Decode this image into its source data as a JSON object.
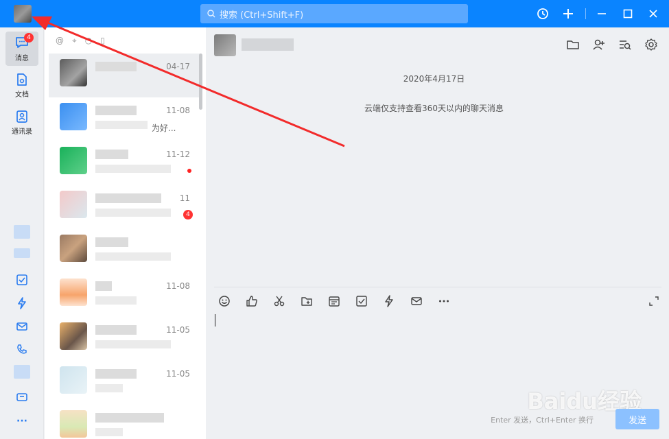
{
  "titlebar": {
    "search_placeholder": "搜索 (Ctrl+Shift+F)"
  },
  "nav": {
    "messages_label": "消息",
    "messages_badge": "4",
    "docs_label": "文档",
    "contacts_label": "通讯录",
    "more_label": "···"
  },
  "conversations": [
    {
      "date": "04-17",
      "preview_text": ""
    },
    {
      "date": "11-08",
      "preview_text": "为好..."
    },
    {
      "date": "11-12",
      "preview_text": ""
    },
    {
      "date": "11",
      "preview_text": "",
      "badge": "4"
    },
    {
      "date": "",
      "preview_text": ""
    },
    {
      "date": "11-08",
      "preview_text": ""
    },
    {
      "date": "11-05",
      "preview_text": ""
    },
    {
      "date": "11-05",
      "preview_text": ""
    }
  ],
  "chat": {
    "date_label": "2020年4月17日",
    "notice": "云端仅支持查看360天以内的聊天消息",
    "send_hint": "Enter 发送，Ctrl+Enter 换行",
    "send_label": "发送"
  },
  "watermark": "Baidu经验",
  "colors": {
    "titlebar": "#0a84ff",
    "accent": "#2a7cf0",
    "badge": "#ff3333",
    "annotation_arrow": "#f22b2b"
  }
}
